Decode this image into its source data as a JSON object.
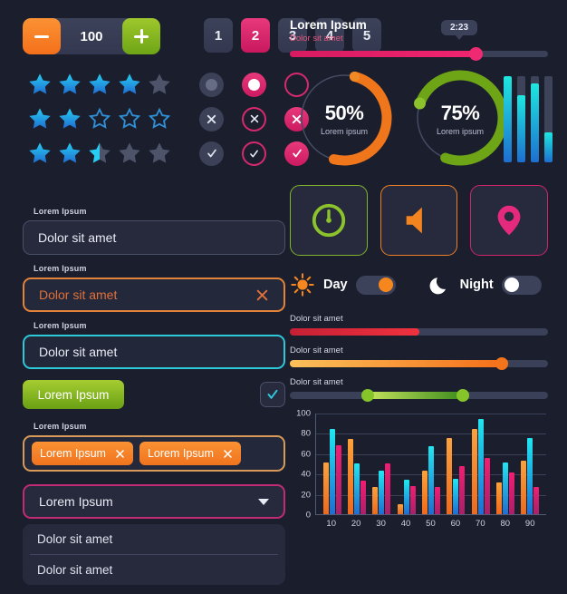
{
  "stepper": {
    "minus_icon": "minus-icon",
    "value": "100",
    "plus_icon": "plus-icon"
  },
  "pagination": {
    "pages": [
      "1",
      "2",
      "3",
      "4",
      "5"
    ],
    "active": "2",
    "active_color": "#e8397c"
  },
  "ratings": [
    {
      "filled": 4,
      "half": 0,
      "empty": 1,
      "style": "solid"
    },
    {
      "filled": 2,
      "half": 0,
      "empty": 3,
      "style": "outline"
    },
    {
      "filled": 2,
      "half": 1,
      "empty": 2,
      "style": "solid-gray"
    }
  ],
  "controls": [
    [
      {
        "name": "radio-unselected",
        "variant": "gray-dot"
      },
      {
        "name": "radio-selected",
        "variant": "pink-dot"
      },
      {
        "name": "radio-empty-outline",
        "variant": "pink-outline-empty"
      }
    ],
    [
      {
        "name": "close-gray",
        "variant": "gray-x"
      },
      {
        "name": "close-outline",
        "variant": "pink-outline-x"
      },
      {
        "name": "close-filled",
        "variant": "pink-fill-x"
      }
    ],
    [
      {
        "name": "check-gray",
        "variant": "gray-check"
      },
      {
        "name": "check-outline",
        "variant": "pink-outline-check"
      },
      {
        "name": "check-filled",
        "variant": "pink-fill-check"
      }
    ]
  ],
  "fields": {
    "input_default": {
      "label": "Lorem Ipsum",
      "value": "Dolor sit amet"
    },
    "input_error": {
      "label": "Lorem Ipsum",
      "value": "Dolor sit amet",
      "clear_icon": "close-icon",
      "color": "#e2703a"
    },
    "input_focus": {
      "label": "Lorem Ipsum",
      "value": "Dolor sit amet",
      "color": "#2ec8d8"
    },
    "submit_button": {
      "label": "Lorem Ipsum"
    },
    "checkbox": {
      "checked": true,
      "check_icon": "check-icon"
    },
    "tags_field": {
      "label": "Lorem Ipsum",
      "tags": [
        {
          "label": "Lorem Ipsum",
          "remove_icon": "close-icon"
        },
        {
          "label": "Lorem Ipsum",
          "remove_icon": "close-icon"
        }
      ]
    },
    "select": {
      "value": "Lorem Ipsum",
      "caret_icon": "chevron-down-icon"
    },
    "options": [
      "Dolor sit amet",
      "Dolor sit amet"
    ]
  },
  "progress_player": {
    "title": "Lorem Ipsum",
    "subtitle": "Dolor sit amet",
    "tooltip": "2:23",
    "percent": 72,
    "color": "#ef2a73"
  },
  "donuts": [
    {
      "percent_label": "50%",
      "percent": 50,
      "sub": "Lorem ipsum",
      "color": "#f0761c"
    },
    {
      "percent_label": "75%",
      "percent": 75,
      "sub": "Lorem ipsum",
      "color": "#6ea516"
    }
  ],
  "vertical_bars": {
    "values": [
      100,
      78,
      92,
      35
    ],
    "color": "#1ee7e0"
  },
  "tiles": [
    {
      "name": "timer-icon",
      "color": "#7fb52a"
    },
    {
      "name": "volume-icon",
      "color": "#ef7f24"
    },
    {
      "name": "location-pin-icon",
      "color": "#d0246c"
    }
  ],
  "toggles": [
    {
      "icon": "sun-icon",
      "label": "Day",
      "on": true
    },
    {
      "icon": "moon-icon",
      "label": "Night",
      "on": false
    }
  ],
  "sliders": [
    {
      "label": "Dolor sit amet",
      "value": 50,
      "color": "#f0323f",
      "knob": false,
      "range": false
    },
    {
      "label": "Dolor sit amet",
      "value": 82,
      "color": "#f4701a",
      "knob": true,
      "range": false
    },
    {
      "label": "Dolor sit amet",
      "low": 30,
      "high": 67,
      "color": "#3d8c1e",
      "knob": true,
      "range": true
    }
  ],
  "chart_data": {
    "type": "bar",
    "title": "",
    "xlabel": "",
    "ylabel": "",
    "categories": [
      "10",
      "20",
      "30",
      "40",
      "50",
      "60",
      "70",
      "80",
      "90"
    ],
    "series": [
      {
        "name": "series-orange",
        "color": "#ef6a1b",
        "values": [
          51,
          74,
          27,
          10,
          43,
          75,
          84,
          31,
          53
        ]
      },
      {
        "name": "series-cyan",
        "color": "#21e6f0",
        "values": [
          84,
          50,
          43,
          34,
          67,
          35,
          94,
          51,
          75
        ]
      },
      {
        "name": "series-pink",
        "color": "#f21d72",
        "values": [
          68,
          33,
          50,
          28,
          27,
          47,
          55,
          41,
          27
        ]
      }
    ],
    "ylim": [
      0,
      100
    ],
    "yticks": [
      0,
      20,
      40,
      60,
      80,
      100
    ],
    "grid": true,
    "legend": "none"
  }
}
